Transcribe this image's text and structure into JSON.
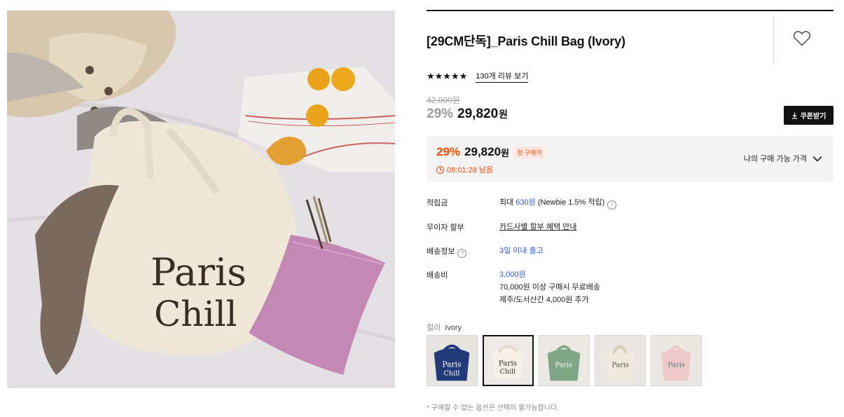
{
  "product": {
    "title": "[29CM단독]_Paris Chill Bag (Ivory)",
    "bag_print_line1": "Paris",
    "bag_print_line2": "Chill"
  },
  "rating": {
    "stars": "★★★★★",
    "review_link": "130개 리뷰 보기"
  },
  "price": {
    "original": "42,000원",
    "discount": "29%",
    "sale": "29,820",
    "unit": "원"
  },
  "coupon": {
    "label": "쿠폰받기",
    "icon": "download-icon"
  },
  "promo": {
    "discount": "29%",
    "price": "29,820",
    "unit": "원",
    "badge": "첫 구매가",
    "timer": "08:01:28 남음",
    "right_label": "나의 구매 가능 가격"
  },
  "info": {
    "points_label": "적립금",
    "points_prefix": "최대 ",
    "points_value": "630원",
    "points_suffix": " (Newbie 1.5% 적립)",
    "installment_label": "무이자 할부",
    "installment_value": "카드사별 할부 혜택 안내",
    "shipping_label": "배송정보",
    "shipping_value": "3일 이내 출고",
    "fee_label": "배송비",
    "fee_value": "3,000원",
    "fee_line2": "70,000원 이상 구매시 무료배송",
    "fee_line3": "제주/도서산간 4,000원 추가"
  },
  "color": {
    "label": "컬러",
    "selected": "Ivory",
    "options": [
      "Navy",
      "Ivory",
      "Green",
      "Beige",
      "Pink"
    ]
  },
  "footnote": "* 구매할 수 없는 옵션은 선택이 불가능합니다.",
  "colors": {
    "accent": "#ff4800",
    "link_blue": "#2f5bd8",
    "badge_bg": "#ffe6df",
    "promo_bg": "#f4f4f4"
  }
}
